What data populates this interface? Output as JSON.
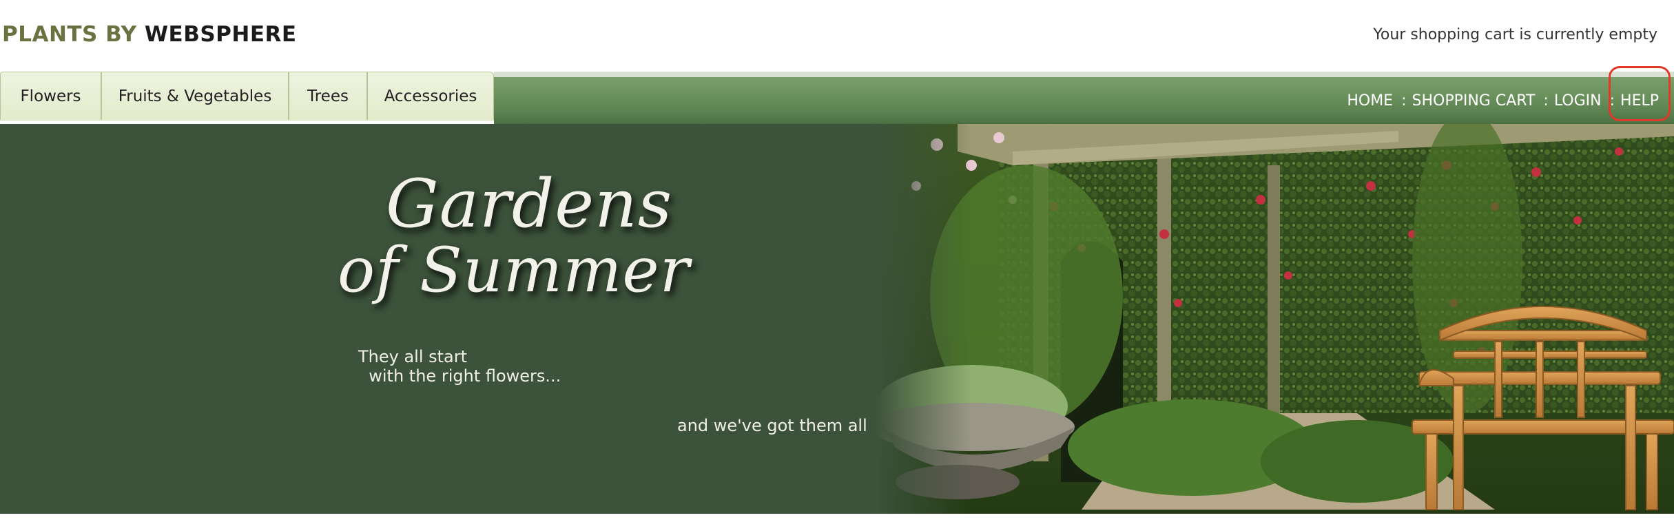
{
  "header": {
    "logo_part1": "PLANTS BY",
    "logo_part2": "WEBSPHERE",
    "cart_status": "Your shopping cart is currently empty"
  },
  "nav": {
    "tabs": [
      {
        "label": "Flowers"
      },
      {
        "label": "Fruits & Vegetables"
      },
      {
        "label": "Trees"
      },
      {
        "label": "Accessories"
      }
    ],
    "links": {
      "home": "HOME",
      "cart": "SHOPPING CART",
      "login": "LOGIN",
      "help": "HELP",
      "separator": ":"
    }
  },
  "hero": {
    "title_line1": "Gardens",
    "title_line2": "of Summer",
    "subtitle": "They all start\n  with the right flowers...",
    "tagline": "and we've got them all"
  },
  "colors": {
    "logo_olive": "#6b7140",
    "nav_green": "#6e9460",
    "hero_green": "#3c523a",
    "tab_bg": "#e3ebcc",
    "highlight_red": "#e03a2a"
  }
}
